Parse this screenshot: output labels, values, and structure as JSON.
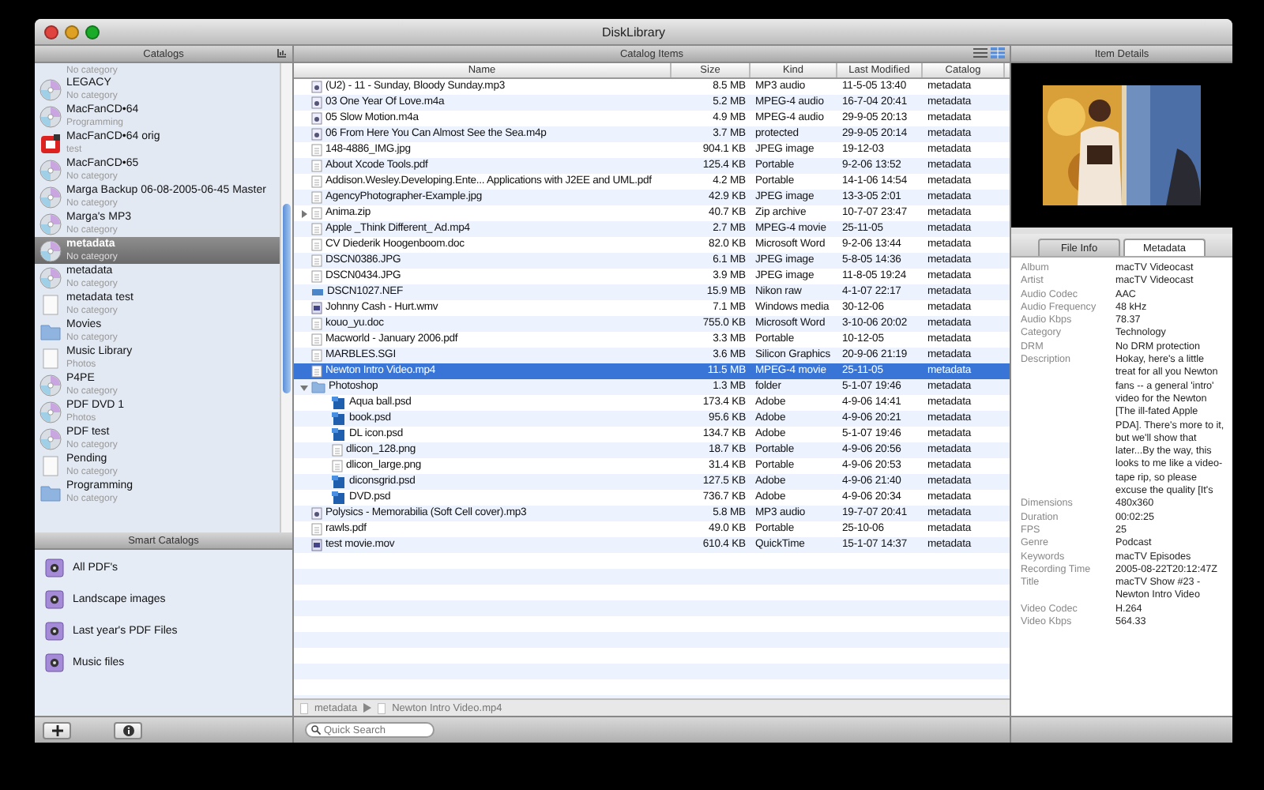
{
  "window": {
    "title": "DiskLibrary"
  },
  "catalogs": {
    "title": "Catalogs",
    "items": [
      {
        "subtitle": "No category",
        "selected": false
      },
      {
        "kind": "disc",
        "name": "LEGACY",
        "subtitle": "No category",
        "selected": false
      },
      {
        "kind": "disc",
        "name": "MacFanCD•64",
        "subtitle": "Programming",
        "selected": false
      },
      {
        "kind": "app",
        "name": "MacFanCD•64 orig",
        "subtitle": "test",
        "selected": false
      },
      {
        "kind": "disc",
        "name": "MacFanCD•65",
        "subtitle": "No category",
        "selected": false
      },
      {
        "kind": "disc",
        "name": "Marga Backup 06-08-2005-06-45 Master",
        "subtitle": "No category",
        "selected": false
      },
      {
        "kind": "disc",
        "name": "Marga's MP3",
        "subtitle": "No category",
        "selected": false
      },
      {
        "kind": "disc",
        "name": "metadata",
        "subtitle": "No category",
        "selected": true
      },
      {
        "kind": "disc",
        "name": "metadata",
        "subtitle": "No category",
        "selected": false
      },
      {
        "kind": "document",
        "name": "metadata test",
        "subtitle": "No category",
        "selected": false
      },
      {
        "kind": "folder",
        "name": "Movies",
        "subtitle": "No category",
        "selected": false
      },
      {
        "kind": "document",
        "name": "Music Library",
        "subtitle": "Photos",
        "selected": false
      },
      {
        "kind": "disc",
        "name": "P4PE",
        "subtitle": "No category",
        "selected": false
      },
      {
        "kind": "disc",
        "name": "PDF DVD 1",
        "subtitle": "Photos",
        "selected": false
      },
      {
        "kind": "disc",
        "name": "PDF test",
        "subtitle": "No category",
        "selected": false
      },
      {
        "kind": "document",
        "name": "Pending",
        "subtitle": "No category",
        "selected": false
      },
      {
        "kind": "folder",
        "name": "Programming",
        "subtitle": "No category",
        "selected": false
      }
    ]
  },
  "smart_catalogs": {
    "title": "Smart Catalogs",
    "items": [
      {
        "name": "All PDF's"
      },
      {
        "name": "Landscape images"
      },
      {
        "name": "Last year's PDF Files"
      },
      {
        "name": "Music files"
      }
    ]
  },
  "catalog_items": {
    "title": "Catalog Items",
    "columns": [
      "Name",
      "Size",
      "Kind",
      "Last Modified",
      "Catalog"
    ],
    "rows": [
      {
        "kind": "audio",
        "name": "(U2) - 11 - Sunday, Bloody Sunday.mp3",
        "size": "8.5 MB",
        "file_type": "MP3 audio",
        "modified": "11-5-05 13:40",
        "catalog": "metadata",
        "selected": false
      },
      {
        "kind": "audio",
        "name": "03 One Year Of Love.m4a",
        "size": "5.2 MB",
        "file_type": "MPEG-4 audio",
        "modified": "16-7-04 20:41",
        "catalog": "metadata",
        "selected": false
      },
      {
        "kind": "audio",
        "name": "05 Slow Motion.m4a",
        "size": "4.9 MB",
        "file_type": "MPEG-4 audio",
        "modified": "29-9-05 20:13",
        "catalog": "metadata",
        "selected": false
      },
      {
        "kind": "audio",
        "name": "06 From Here You Can Almost See the Sea.m4p",
        "size": "3.7 MB",
        "file_type": "protected",
        "modified": "29-9-05 20:14",
        "catalog": "metadata",
        "selected": false
      },
      {
        "kind": "document",
        "name": "148-4886_IMG.jpg",
        "size": "904.1 KB",
        "file_type": "JPEG image",
        "modified": "19-12-03",
        "catalog": "metadata",
        "selected": false
      },
      {
        "kind": "document",
        "name": "About Xcode Tools.pdf",
        "size": "125.4 KB",
        "file_type": "Portable",
        "modified": "9-2-06 13:52",
        "catalog": "metadata",
        "selected": false
      },
      {
        "kind": "document",
        "name": "Addison.Wesley.Developing.Ente... Applications with J2EE and UML.pdf",
        "size": "4.2 MB",
        "file_type": "Portable",
        "modified": "14-1-06 14:54",
        "catalog": "metadata",
        "selected": false
      },
      {
        "kind": "document",
        "name": "AgencyPhotographer-Example.jpg",
        "size": "42.9 KB",
        "file_type": "JPEG image",
        "modified": "13-3-05 2:01",
        "catalog": "metadata",
        "selected": false
      },
      {
        "kind": "document",
        "name": "Anima.zip",
        "size": "40.7 KB",
        "file_type": "Zip archive",
        "modified": "10-7-07 23:47",
        "catalog": "metadata",
        "selected": false,
        "expanded": false
      },
      {
        "kind": "document",
        "name": "Apple _Think Different_ Ad.mp4",
        "size": "2.7 MB",
        "file_type": "MPEG-4 movie",
        "modified": "25-11-05",
        "catalog": "metadata",
        "selected": false
      },
      {
        "kind": "document",
        "name": "CV Diederik Hoogenboom.doc",
        "size": "82.0 KB",
        "file_type": "Microsoft Word",
        "modified": "9-2-06 13:44",
        "catalog": "metadata",
        "selected": false
      },
      {
        "kind": "document",
        "name": "DSCN0386.JPG",
        "size": "6.1 MB",
        "file_type": "JPEG image",
        "modified": "5-8-05 14:36",
        "catalog": "metadata",
        "selected": false
      },
      {
        "kind": "document",
        "name": "DSCN0434.JPG",
        "size": "3.9 MB",
        "file_type": "JPEG image",
        "modified": "11-8-05 19:24",
        "catalog": "metadata",
        "selected": false
      },
      {
        "kind": "raw",
        "name": "DSCN1027.NEF",
        "size": "15.9 MB",
        "file_type": "Nikon raw",
        "modified": "4-1-07 22:17",
        "catalog": "metadata",
        "selected": false
      },
      {
        "kind": "movie",
        "name": "Johnny Cash - Hurt.wmv",
        "size": "7.1 MB",
        "file_type": "Windows media",
        "modified": "30-12-06",
        "catalog": "metadata",
        "selected": false
      },
      {
        "kind": "document",
        "name": "kouo_yu.doc",
        "size": "755.0 KB",
        "file_type": "Microsoft Word",
        "modified": "3-10-06 20:02",
        "catalog": "metadata",
        "selected": false
      },
      {
        "kind": "document",
        "name": "Macworld - January 2006.pdf",
        "size": "3.3 MB",
        "file_type": "Portable",
        "modified": "10-12-05",
        "catalog": "metadata",
        "selected": false
      },
      {
        "kind": "document",
        "name": "MARBLES.SGI",
        "size": "3.6 MB",
        "file_type": "Silicon Graphics",
        "modified": "20-9-06 21:19",
        "catalog": "metadata",
        "selected": false
      },
      {
        "kind": "document",
        "name": "Newton Intro Video.mp4",
        "size": "11.5 MB",
        "file_type": "MPEG-4 movie",
        "modified": "25-11-05",
        "catalog": "metadata",
        "selected": true
      },
      {
        "kind": "folder",
        "name": "Photoshop",
        "size": "1.3 MB",
        "file_type": "folder",
        "modified": "5-1-07 19:46",
        "catalog": "metadata",
        "selected": false,
        "expanded": true,
        "children": [
          {
            "kind": "psd",
            "name": "Aqua ball.psd",
            "size": "173.4 KB",
            "file_type": "Adobe",
            "modified": "4-9-06 14:41",
            "catalog": "metadata",
            "selected": false
          },
          {
            "kind": "psd",
            "name": "book.psd",
            "size": "95.6 KB",
            "file_type": "Adobe",
            "modified": "4-9-06 20:21",
            "catalog": "metadata",
            "selected": false
          },
          {
            "kind": "psd",
            "name": "DL icon.psd",
            "size": "134.7 KB",
            "file_type": "Adobe",
            "modified": "5-1-07 19:46",
            "catalog": "metadata",
            "selected": false
          },
          {
            "kind": "document",
            "name": "dlicon_128.png",
            "size": "18.7 KB",
            "file_type": "Portable",
            "modified": "4-9-06 20:56",
            "catalog": "metadata",
            "selected": false
          },
          {
            "kind": "document",
            "name": "dlicon_large.png",
            "size": "31.4 KB",
            "file_type": "Portable",
            "modified": "4-9-06 20:53",
            "catalog": "metadata",
            "selected": false
          },
          {
            "kind": "psd",
            "name": "diconsgrid.psd",
            "size": "127.5 KB",
            "file_type": "Adobe",
            "modified": "4-9-06 21:40",
            "catalog": "metadata",
            "selected": false
          },
          {
            "kind": "psd",
            "name": "DVD.psd",
            "size": "736.7 KB",
            "file_type": "Adobe",
            "modified": "4-9-06 20:34",
            "catalog": "metadata",
            "selected": false
          }
        ]
      },
      {
        "kind": "audio",
        "name": "Polysics - Memorabilia (Soft Cell cover).mp3",
        "size": "5.8 MB",
        "file_type": "MP3 audio",
        "modified": "19-7-07 20:41",
        "catalog": "metadata",
        "selected": false
      },
      {
        "kind": "document",
        "name": "rawls.pdf",
        "size": "49.0 KB",
        "file_type": "Portable",
        "modified": "25-10-06",
        "catalog": "metadata",
        "selected": false
      },
      {
        "kind": "movie",
        "name": "test movie.mov",
        "size": "610.4 KB",
        "file_type": "QuickTime",
        "modified": "15-1-07 14:37",
        "catalog": "metadata",
        "selected": false
      }
    ]
  },
  "path_bar": [
    "metadata",
    "Newton Intro Video.mp4"
  ],
  "search": {
    "placeholder": "Quick Search"
  },
  "item_details": {
    "title": "Item Details",
    "tabs": [
      {
        "label": "File Info",
        "selected": false
      },
      {
        "label": "Metadata",
        "selected": true
      }
    ],
    "fields": [
      {
        "label": "Album",
        "value": "macTV Videocast"
      },
      {
        "label": "Artist",
        "value": "macTV Videocast"
      },
      {
        "label": "Audio Codec",
        "value": "AAC"
      },
      {
        "label": "Audio Frequency",
        "value": "48 kHz"
      },
      {
        "label": "Audio Kbps",
        "value": "78.37"
      },
      {
        "label": "Category",
        "value": "Technology"
      },
      {
        "label": "DRM",
        "value": "No DRM protection"
      },
      {
        "label": "Description",
        "value": "Hokay, here's a little treat for all you Newton fans -- a general 'intro' video for the Newton [The ill-fated Apple PDA]. There's more to it, but we'll show that later...By the way, this looks to me like a video-tape rip, so please excuse the quality [It's"
      },
      {
        "label": "Dimensions",
        "value": "480x360"
      },
      {
        "label": "Duration",
        "value": "00:02:25"
      },
      {
        "label": "FPS",
        "value": "25"
      },
      {
        "label": "Genre",
        "value": "Podcast"
      },
      {
        "label": "Keywords",
        "value": "macTV Episodes"
      },
      {
        "label": "Recording Time",
        "value": "2005-08-22T20:12:47Z"
      },
      {
        "label": "Title",
        "value": "macTV Show #23 - Newton Intro Video"
      },
      {
        "label": "Video Codec",
        "value": "H.264"
      },
      {
        "label": "Video Kbps",
        "value": "564.33"
      }
    ]
  }
}
